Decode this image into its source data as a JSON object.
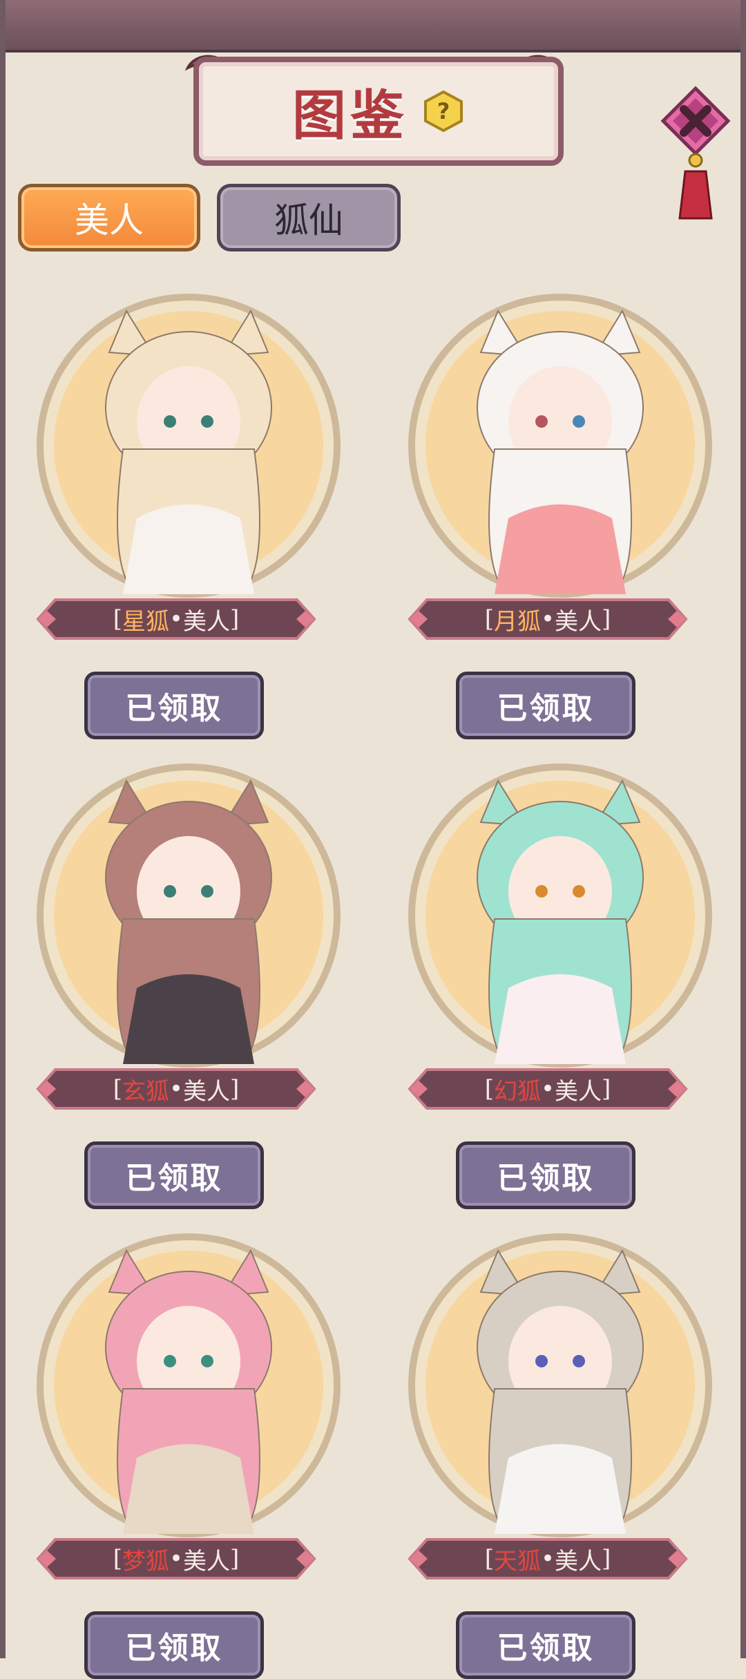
{
  "header": {
    "title": "图鉴"
  },
  "tabs": [
    {
      "label": "美人",
      "active": true
    },
    {
      "label": "狐仙",
      "active": false
    }
  ],
  "cards": [
    {
      "name_prefix": "星狐",
      "name_dot": "•",
      "name_suffix": "美人",
      "button": "已领取",
      "hair": "#f3e2c5",
      "outfit": "#f7f2ee"
    },
    {
      "name_prefix": "月狐",
      "name_dot": "•",
      "name_suffix": "美人",
      "button": "已领取",
      "hair": "#f6f3f1",
      "outfit": "#f59fa1"
    },
    {
      "name_prefix": "玄狐",
      "name_dot": "•",
      "name_suffix": "美人",
      "button": "已领取",
      "hair": "#b48079",
      "outfit": "#4b4249"
    },
    {
      "name_prefix": "幻狐",
      "name_dot": "•",
      "name_suffix": "美人",
      "button": "已领取",
      "hair": "#9fe2d0",
      "outfit": "#fbeef1"
    },
    {
      "name_prefix": "梦狐",
      "name_dot": "•",
      "name_suffix": "美人",
      "button": "已领取",
      "hair": "#f2a4b7",
      "outfit": "#e8d8c6"
    },
    {
      "name_prefix": "天狐",
      "name_dot": "•",
      "name_suffix": "美人",
      "button": "已领取",
      "hair": "#d7cfc4",
      "outfit": "#f6f4f3"
    }
  ],
  "colors": {
    "accent_orange": "#f3893a",
    "banner": "#6e4653",
    "button": "#7e7196",
    "title_red": "#b23b40"
  }
}
